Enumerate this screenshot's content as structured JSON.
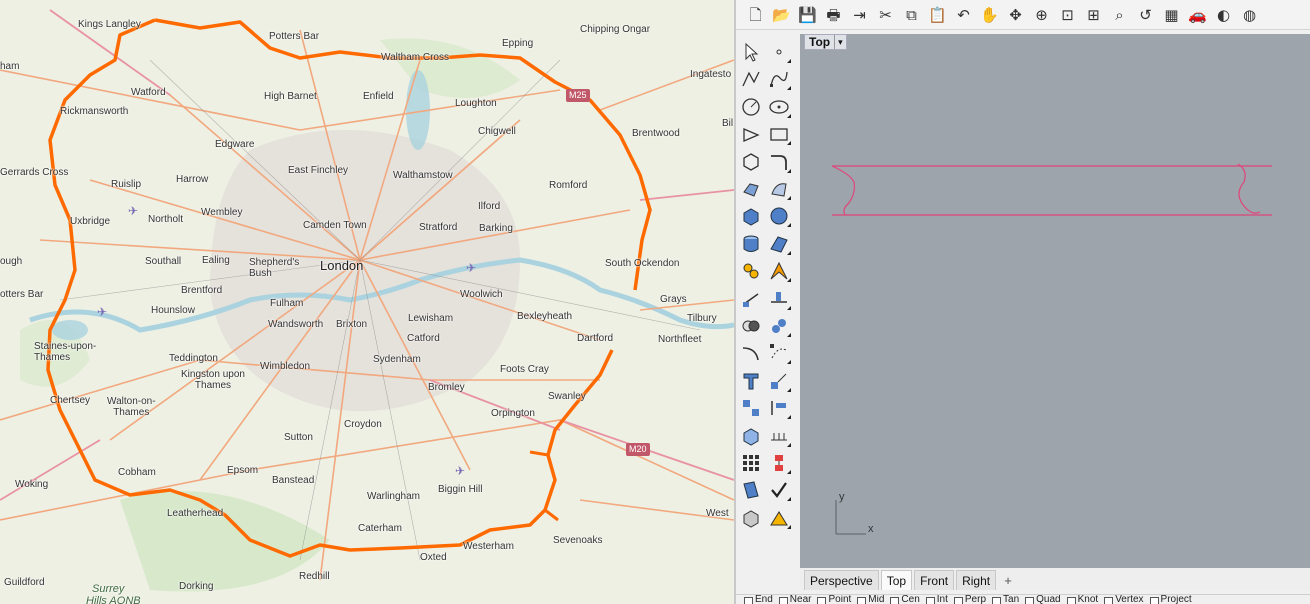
{
  "map": {
    "places": [
      {
        "id": "kings-langley",
        "text": "Kings Langley"
      },
      {
        "id": "potters-bar",
        "text": "Potters Bar"
      },
      {
        "id": "epping",
        "text": "Epping"
      },
      {
        "id": "chipping-ongar",
        "text": "Chipping Ongar"
      },
      {
        "id": "ingatestone",
        "text": "Ingatesto"
      },
      {
        "id": "waltham-cross",
        "text": "Waltham Cross"
      },
      {
        "id": "watford",
        "text": "Watford"
      },
      {
        "id": "high-barnet",
        "text": "High Barnet"
      },
      {
        "id": "enfield",
        "text": "Enfield"
      },
      {
        "id": "loughton",
        "text": "Loughton"
      },
      {
        "id": "rickmansworth",
        "text": "Rickmansworth"
      },
      {
        "id": "chigwell",
        "text": "Chigwell"
      },
      {
        "id": "brentwood",
        "text": "Brentwood"
      },
      {
        "id": "edgware",
        "text": "Edgware"
      },
      {
        "id": "east-finchley",
        "text": "East Finchley"
      },
      {
        "id": "walthamstow",
        "text": "Walthamstow"
      },
      {
        "id": "gerrards-cross",
        "text": "Gerrards Cross"
      },
      {
        "id": "harrow",
        "text": "Harrow"
      },
      {
        "id": "romford",
        "text": "Romford"
      },
      {
        "id": "ruislip",
        "text": "Ruislip"
      },
      {
        "id": "wembley",
        "text": "Wembley"
      },
      {
        "id": "ilford",
        "text": "Ilford"
      },
      {
        "id": "uxbridge",
        "text": "Uxbridge"
      },
      {
        "id": "northolt",
        "text": "Northolt"
      },
      {
        "id": "camden-town",
        "text": "Camden Town"
      },
      {
        "id": "stratford",
        "text": "Stratford"
      },
      {
        "id": "barking",
        "text": "Barking"
      },
      {
        "id": "southall",
        "text": "Southall"
      },
      {
        "id": "ealing",
        "text": "Ealing"
      },
      {
        "id": "shepherds-bush",
        "text": "Shepherd's\nBush"
      },
      {
        "id": "london",
        "text": "London"
      },
      {
        "id": "south-ockendon",
        "text": "South Ockendon"
      },
      {
        "id": "brentford",
        "text": "Brentford"
      },
      {
        "id": "fulham",
        "text": "Fulham"
      },
      {
        "id": "woolwich",
        "text": "Woolwich"
      },
      {
        "id": "grays",
        "text": "Grays"
      },
      {
        "id": "tilbury",
        "text": "Tilbury"
      },
      {
        "id": "hounslow",
        "text": "Hounslow"
      },
      {
        "id": "wandsworth",
        "text": "Wandsworth"
      },
      {
        "id": "brixton",
        "text": "Brixton"
      },
      {
        "id": "lewisham",
        "text": "Lewisham"
      },
      {
        "id": "bexleyheath",
        "text": "Bexleyheath"
      },
      {
        "id": "staines",
        "text": "Staines-upon-\nThames"
      },
      {
        "id": "catford",
        "text": "Catford"
      },
      {
        "id": "dartford",
        "text": "Dartford"
      },
      {
        "id": "northfleet",
        "text": "Northfleet"
      },
      {
        "id": "teddington",
        "text": "Teddington"
      },
      {
        "id": "sydenham",
        "text": "Sydenham"
      },
      {
        "id": "wimbledon",
        "text": "Wimbledon"
      },
      {
        "id": "kingston",
        "text": "Kingston upon\nThames"
      },
      {
        "id": "foots-cray",
        "text": "Foots Cray"
      },
      {
        "id": "bromley",
        "text": "Bromley"
      },
      {
        "id": "swanley",
        "text": "Swanley"
      },
      {
        "id": "chertsey",
        "text": "Chertsey"
      },
      {
        "id": "walton",
        "text": "Walton-on-\nThames"
      },
      {
        "id": "orpington",
        "text": "Orpington"
      },
      {
        "id": "croydon",
        "text": "Croydon"
      },
      {
        "id": "sutton",
        "text": "Sutton"
      },
      {
        "id": "epsom",
        "text": "Epsom"
      },
      {
        "id": "cobham",
        "text": "Cobham"
      },
      {
        "id": "banstead",
        "text": "Banstead"
      },
      {
        "id": "biggin-hill",
        "text": "Biggin Hill"
      },
      {
        "id": "woking",
        "text": "Woking"
      },
      {
        "id": "warlingham",
        "text": "Warlingham"
      },
      {
        "id": "leatherhead",
        "text": "Leatherhead"
      },
      {
        "id": "west",
        "text": "West"
      },
      {
        "id": "caterham",
        "text": "Caterham"
      },
      {
        "id": "westerham",
        "text": "Westerham"
      },
      {
        "id": "sevenoaks",
        "text": "Sevenoaks"
      },
      {
        "id": "oxted",
        "text": "Oxted"
      },
      {
        "id": "redhill",
        "text": "Redhill"
      },
      {
        "id": "dorking",
        "text": "Dorking"
      },
      {
        "id": "guildford",
        "text": "Guildford"
      },
      {
        "id": "surrey",
        "text": "Surrey"
      },
      {
        "id": "surrey-hills",
        "text": "Hills AONB"
      },
      {
        "id": "ham",
        "text": "ham"
      },
      {
        "id": "ough",
        "text": "ough"
      },
      {
        "id": "otters",
        "text": "otters Bar"
      },
      {
        "id": "bil",
        "text": "Bil"
      }
    ],
    "road_shields": [
      {
        "id": "m25",
        "text": "M25"
      },
      {
        "id": "m20",
        "text": "M20"
      }
    ],
    "colors": {
      "m25_ring": "#ff6a00",
      "background": "#eef0e4",
      "urban": "#e2ddd8",
      "water": "#aad3df",
      "road_major": "#f2a87e",
      "road_trunk": "#e892a2"
    }
  },
  "rhino": {
    "toolbar_icons": [
      "new-icon",
      "open-icon",
      "save-icon",
      "print-icon",
      "import-icon",
      "cut-icon",
      "copy-icon",
      "paste-icon",
      "undo-icon",
      "pan-icon",
      "rotate-view-icon",
      "zoom-icon",
      "zoom-window-icon",
      "zoom-extents-icon",
      "zoom-selected-icon",
      "undo-view-icon",
      "four-viewports-icon",
      "car-icon",
      "shade-icon",
      "render-icon"
    ],
    "toolbar_glyphs": [
      "🗋",
      "📂",
      "💾",
      "🖶",
      "⇥",
      "✂",
      "⧉",
      "📋",
      "↶",
      "✋",
      "✥",
      "⊕",
      "⊡",
      "⊞",
      "⌕",
      "↺",
      "▦",
      "🚗",
      "◐",
      "◍"
    ],
    "sidebar_tools": [
      {
        "left": "select-icon",
        "right": "point-icon"
      },
      {
        "left": "polyline-icon",
        "right": "curve-icon"
      },
      {
        "left": "circle-icon",
        "right": "ellipse-icon"
      },
      {
        "left": "arc-icon",
        "right": "rectangle-icon"
      },
      {
        "left": "polygon-icon",
        "right": "fillet-icon"
      },
      {
        "left": "surface-points-icon",
        "right": "surface-edge-icon"
      },
      {
        "left": "box-icon",
        "right": "sphere-icon"
      },
      {
        "left": "cylinder-icon",
        "right": "mesh-icon"
      },
      {
        "left": "transform-icon",
        "right": "explode-icon"
      },
      {
        "left": "trim-icon",
        "right": "split-icon"
      },
      {
        "left": "boolean-union-icon",
        "right": "boolean-split-icon"
      },
      {
        "left": "rebuild-icon",
        "right": "edit-points-icon"
      },
      {
        "left": "text-icon",
        "right": "scale-icon"
      },
      {
        "left": "array-icon",
        "right": "align-icon"
      },
      {
        "left": "block-icon",
        "right": "dimension-icon"
      },
      {
        "left": "grid-icon",
        "right": "group-icon"
      },
      {
        "left": "layers-icon",
        "right": "check-icon"
      },
      {
        "left": "solid-icon",
        "right": "render-mesh-icon"
      }
    ],
    "viewport": {
      "title": "Top",
      "menu_arrow": "▾",
      "background": "#9da4ab",
      "curve_color": "#e0457a",
      "axis_x": "x",
      "axis_y": "y"
    },
    "tabs": [
      {
        "label": "Perspective",
        "active": false
      },
      {
        "label": "Top",
        "active": true
      },
      {
        "label": "Front",
        "active": false
      },
      {
        "label": "Right",
        "active": false
      }
    ],
    "add_tab": "+",
    "osnaps": [
      "End",
      "Near",
      "Point",
      "Mid",
      "Cen",
      "Int",
      "Perp",
      "Tan",
      "Quad",
      "Knot",
      "Vertex",
      "Project"
    ]
  }
}
